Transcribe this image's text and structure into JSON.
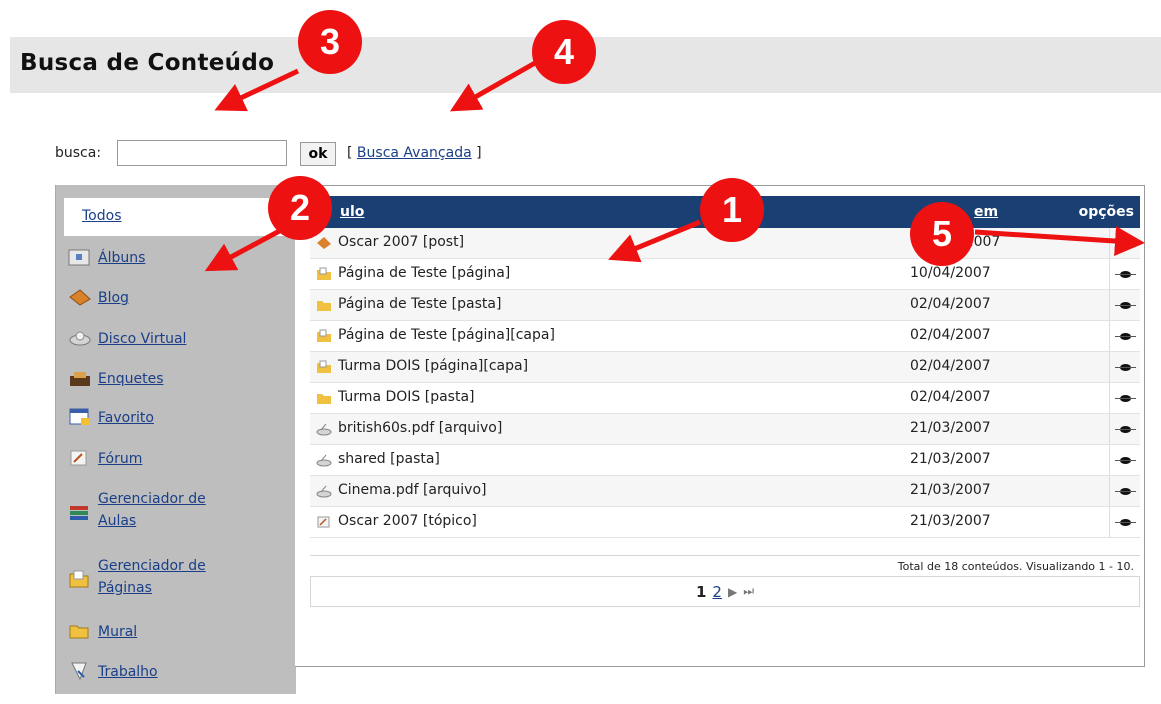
{
  "page": {
    "title": "Busca de Conteúdo"
  },
  "search": {
    "label": "busca:",
    "value": "",
    "placeholder": "",
    "ok_label": "ok",
    "bracket_open": "[",
    "advanced_label": "Busca Avançada",
    "bracket_close": "]"
  },
  "sidebar": {
    "items": [
      {
        "label": "Todos",
        "icon": "none"
      },
      {
        "label": "Álbuns",
        "icon": "album-icon"
      },
      {
        "label": "Blog",
        "icon": "blog-icon"
      },
      {
        "label": "Disco Virtual",
        "icon": "disk-icon"
      },
      {
        "label": "Enquetes",
        "icon": "poll-icon"
      },
      {
        "label": "Favorito",
        "icon": "favorite-icon"
      },
      {
        "label": "Fórum",
        "icon": "forum-icon"
      },
      {
        "label": "Gerenciador de",
        "label2": "Aulas",
        "icon": "classes-icon"
      },
      {
        "label": "Gerenciador de",
        "label2": "Páginas",
        "icon": "pages-icon"
      },
      {
        "label": "Mural",
        "icon": "mural-icon"
      },
      {
        "label": "Trabalho",
        "icon": "work-icon"
      }
    ]
  },
  "table": {
    "columns": {
      "title": "ulo",
      "date": "em",
      "options": "opções"
    },
    "rows": [
      {
        "name": "Oscar 2007 [post]",
        "date": "/2007",
        "icon": "post-icon"
      },
      {
        "name": "Página de Teste [página]",
        "date": "10/04/2007",
        "icon": "page-icon"
      },
      {
        "name": "Página de Teste [pasta]",
        "date": "02/04/2007",
        "icon": "folder-icon"
      },
      {
        "name": "Página de Teste [página][capa]",
        "date": "02/04/2007",
        "icon": "page-icon"
      },
      {
        "name": "Turma DOIS [página][capa]",
        "date": "02/04/2007",
        "icon": "page-icon"
      },
      {
        "name": "Turma DOIS [pasta]",
        "date": "02/04/2007",
        "icon": "folder-icon"
      },
      {
        "name": "british60s.pdf [arquivo]",
        "date": "21/03/2007",
        "icon": "file-icon"
      },
      {
        "name": "shared [pasta]",
        "date": "21/03/2007",
        "icon": "file-icon"
      },
      {
        "name": "Cinema.pdf [arquivo]",
        "date": "21/03/2007",
        "icon": "file-icon"
      },
      {
        "name": "Oscar 2007 [tópico]",
        "date": "21/03/2007",
        "icon": "topic-icon"
      }
    ],
    "total_text": "Total de 18 conteúdos. Visualizando 1 - 10.",
    "pager": {
      "current": "1",
      "next_page": "2",
      "next_symbol": "▶",
      "last_symbol": "⏭"
    }
  },
  "callouts": [
    "1",
    "2",
    "3",
    "4",
    "5"
  ],
  "colors": {
    "header": "#1a3f72",
    "callout": "#ee1111",
    "sidebar": "#bebebe"
  }
}
